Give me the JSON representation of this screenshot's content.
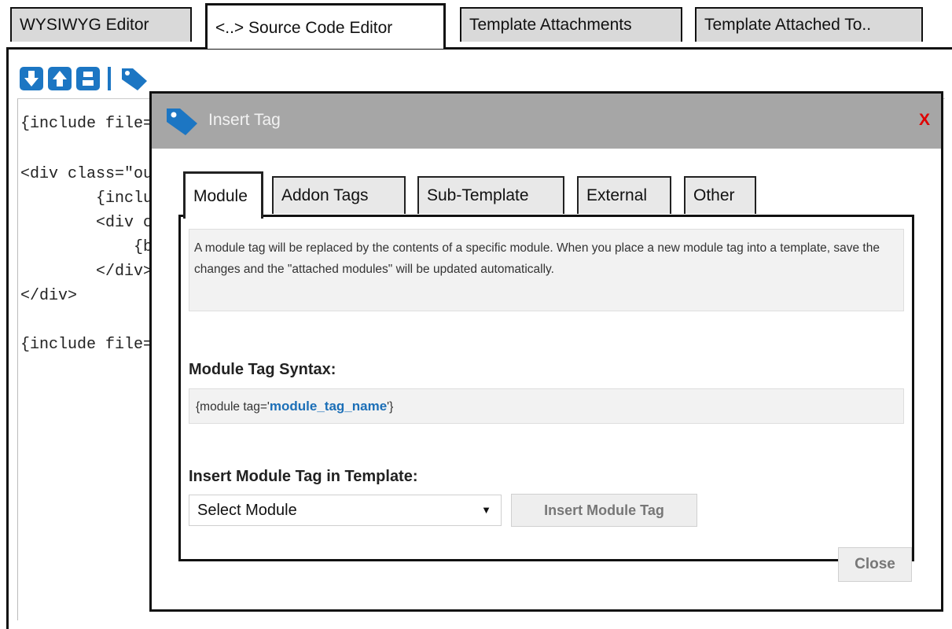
{
  "top_tabs": [
    {
      "label": "WYSIWYG Editor"
    },
    {
      "label": "<..> Source Code Editor"
    },
    {
      "label": "Template Attachments"
    },
    {
      "label": "Template Attached To.."
    }
  ],
  "toolbar": {
    "icons": [
      "download-icon",
      "upload-icon",
      "save-icon",
      "tag-icon"
    ]
  },
  "code": {
    "lines": [
      "{include file=\"header.tpl\"}",
      "",
      "<div class=\"outer_shell\">",
      "        {include file=\"sidebar.tpl\"}",
      "        <div class=\"content_shell\">",
      "            {body_html}",
      "        </div>",
      "</div>",
      "",
      "{include file=\"footer.tpl\"}"
    ]
  },
  "dialog": {
    "title": "Insert Tag",
    "close_label": "X",
    "tabs": [
      {
        "label": "Module"
      },
      {
        "label": "Addon Tags"
      },
      {
        "label": "Sub-Template"
      },
      {
        "label": "External"
      },
      {
        "label": "Other"
      }
    ],
    "description": "A module tag will be replaced by the contents of a specific module. When you place a new module tag into a template, save the changes and the \"attached modules\" will be updated automatically.",
    "syntax_heading": "Module Tag Syntax:",
    "syntax_prefix": "{module tag='",
    "syntax_var": "module_tag_name",
    "syntax_suffix": "'}",
    "insert_heading": "Insert Module Tag in Template:",
    "select_value": "Select Module",
    "insert_button": "Insert Module Tag",
    "close_button": "Close"
  },
  "colors": {
    "accent_blue": "#1c76c3",
    "close_red": "#e00000",
    "title_bar_gray": "#a6a6a6"
  }
}
